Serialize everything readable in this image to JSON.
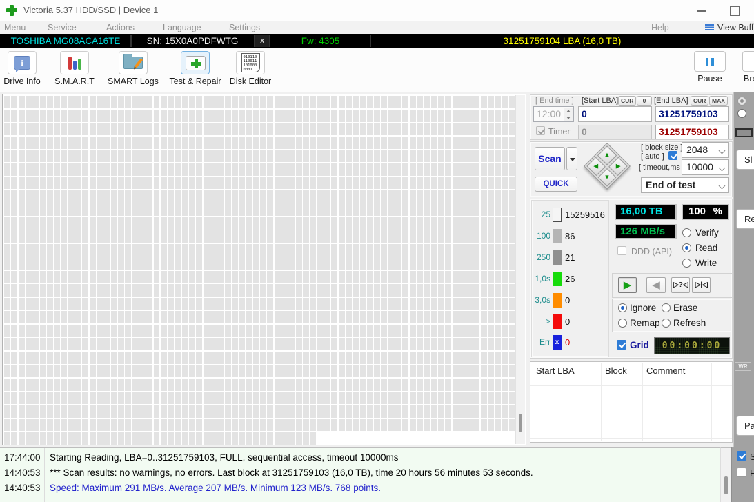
{
  "window": {
    "title": "Victoria 5.37 HDD/SSD | Device 1"
  },
  "menu": {
    "items": [
      "Menu",
      "Service",
      "Actions",
      "Language",
      "Settings"
    ],
    "help": "Help",
    "view_buff": "View Buff"
  },
  "device_bar": {
    "model": "TOSHIBA MG08ACA16TE",
    "serial": "SN: 15X0A0PDFWTG",
    "close": "x",
    "firmware": "Fw: 4305",
    "capacity": "31251759104 LBA (16,0 TB)"
  },
  "toolbar": {
    "items": [
      {
        "label": "Drive Info",
        "selected": false
      },
      {
        "label": "S.M.A.R.T",
        "selected": false
      },
      {
        "label": "SMART Logs",
        "selected": false
      },
      {
        "label": "Test & Repair",
        "selected": true
      },
      {
        "label": "Disk Editor",
        "selected": false
      }
    ],
    "binary": [
      "010110",
      "110011",
      "101000",
      "0001"
    ],
    "pause_label": "Pause",
    "break_label": "Bre"
  },
  "test_panel": {
    "end_time_label": "[ End time ]",
    "start_lba_label": "[Start LBA]",
    "end_lba_label": "[End LBA]",
    "cur_label": "CUR",
    "zero_label": "0",
    "max_label": "MAX",
    "end_time": "12:00",
    "start_lba": "0",
    "end_lba": "31251759103",
    "timer_label": "Timer",
    "timer_current": "0",
    "timer_end": "31251759103",
    "scan_label": "Scan",
    "quick_label": "QUICK",
    "block_size_label": "[ block size ]",
    "auto_label": "[ auto ]",
    "block_size": "2048",
    "timeout_label": "[ timeout,ms ]",
    "timeout": "10000",
    "end_action": "End of test"
  },
  "icons": {
    "arrow_up": "▲",
    "arrow_down": "▼",
    "arrow_left": "◀",
    "arrow_right": "▶",
    "play": "▶",
    "back": "◀",
    "seek": "▷?◁",
    "stop": "▷|◁"
  },
  "stats": {
    "rows": [
      {
        "label": "25",
        "value": "15259516",
        "color": "#f5f5f5",
        "border": "#4a4a4a"
      },
      {
        "label": "100",
        "value": "86",
        "color": "#b5b5b5"
      },
      {
        "label": "250",
        "value": "21",
        "color": "#8f8f8f"
      },
      {
        "label": "1,0s",
        "value": "26",
        "color": "#17dc0b"
      },
      {
        "label": "3,0s",
        "value": "0",
        "color": "#ff8c00"
      },
      {
        "label": ">",
        "value": "0",
        "color": "#f40b0b"
      },
      {
        "label": "Err",
        "value": "0",
        "color": "#1921dc",
        "value_color": "#e00000",
        "icon": "x"
      }
    ]
  },
  "displays": {
    "size": "16,00 TB",
    "percent": "100",
    "percent_unit": "%",
    "speed": "126 MB/s",
    "clock": "00:00:00"
  },
  "checks": {
    "ddd_label": "DDD (API)",
    "grid_label": "Grid"
  },
  "mode": {
    "options": [
      "Verify",
      "Read",
      "Write"
    ],
    "selected": "Read"
  },
  "action": {
    "options": [
      "Ignore",
      "Erase",
      "Remap",
      "Refresh"
    ],
    "selected": "Ignore"
  },
  "defect_table": {
    "headers": [
      "Start LBA",
      "Block",
      "Comment"
    ]
  },
  "side_strip": {
    "button1": "Sl",
    "button2": "Re",
    "wr_label": "WR",
    "button3": "Pa",
    "check1": "S",
    "check2": "H"
  },
  "log": {
    "entries": [
      {
        "time": "17:44:00",
        "text": "Starting Reading, LBA=0..31251759103, FULL, sequential access, timeout 10000ms",
        "color": "#000000"
      },
      {
        "time": "14:40:53",
        "text": "*** Scan results: no warnings, no errors. Last block at 31251759103 (16,0 TB), time 20 hours 56 minutes 53 seconds.",
        "color": "#000000"
      },
      {
        "time": "14:40:53",
        "text": "Speed: Maximum 291 MB/s. Average 207 MB/s. Minimum 123 MB/s. 768 points.",
        "color": "#2323cc"
      }
    ]
  },
  "scan_map": {
    "rows": 25,
    "cols": 72,
    "partial_cells": 44,
    "cell_color": "#e3e3e3"
  },
  "colors": {
    "accent_blue": "#2e7cd6",
    "scan_blue": "#2026c8",
    "navy_value": "#00127d",
    "dark_red_value": "#9c0000",
    "teal_label": "#1c8c8c",
    "lcd_cyan": "#00e2e2",
    "lcd_green": "#00c050",
    "led_yellow": "#a8a83a",
    "grid_cell": "#e3e3e3",
    "log_bg": "#f2fbf2",
    "device_cyan": "#00dede",
    "device_green": "#00d000",
    "device_yellow": "#ffff00",
    "strip_gray": "#a2a2a2"
  }
}
